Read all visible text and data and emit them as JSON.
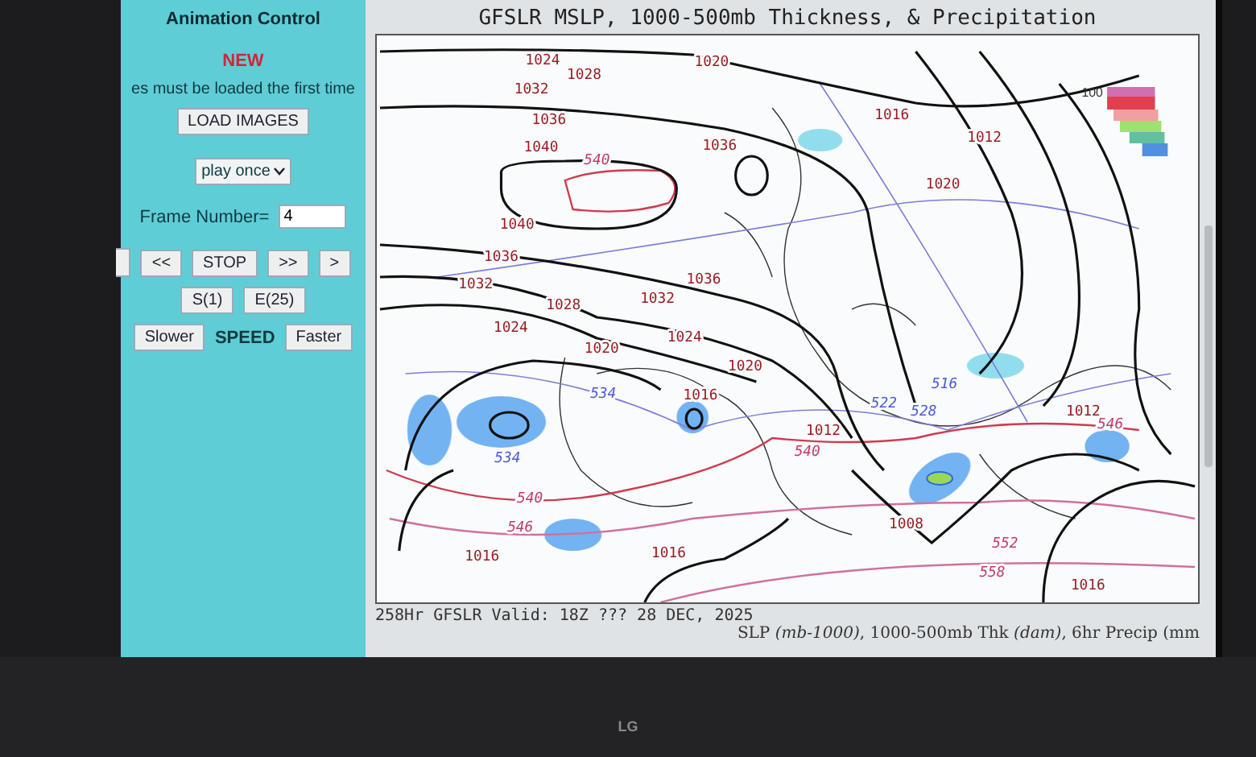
{
  "animation_control": {
    "title": "Animation Control",
    "notice_badge": "NEW",
    "notice": "es must be loaded the first time",
    "load_button": "LOAD IMAGES",
    "play_mode": "play once",
    "frame_label": "Frame Number=",
    "frame_value": "4",
    "nav_buttons": [
      "<<",
      "STOP",
      ">>",
      ">"
    ],
    "range_buttons": [
      "S(1)",
      "E(25)"
    ],
    "speed": {
      "slower": "Slower",
      "label": "SPEED",
      "faster": "Faster"
    }
  },
  "map": {
    "title": "GFSLR MSLP, 1000-500mb Thickness, & Precipitation",
    "legend_label": "100",
    "labels": [
      {
        "text": "1024",
        "kind": "pressure"
      },
      {
        "text": "1028",
        "kind": "pressure"
      },
      {
        "text": "1032",
        "kind": "pressure"
      },
      {
        "text": "1020",
        "kind": "pressure"
      },
      {
        "text": "1036",
        "kind": "pressure"
      },
      {
        "text": "1016",
        "kind": "pressure"
      },
      {
        "text": "1040",
        "kind": "pressure"
      },
      {
        "text": "1036",
        "kind": "pressure"
      },
      {
        "text": "1012",
        "kind": "pressure"
      },
      {
        "text": "1020",
        "kind": "pressure"
      },
      {
        "text": "1040",
        "kind": "pressure"
      },
      {
        "text": "1036",
        "kind": "pressure"
      },
      {
        "text": "1032",
        "kind": "pressure"
      },
      {
        "text": "1036",
        "kind": "pressure"
      },
      {
        "text": "1028",
        "kind": "pressure"
      },
      {
        "text": "1032",
        "kind": "pressure"
      },
      {
        "text": "1024",
        "kind": "pressure"
      },
      {
        "text": "1024",
        "kind": "pressure"
      },
      {
        "text": "1020",
        "kind": "pressure"
      },
      {
        "text": "1020",
        "kind": "pressure"
      },
      {
        "text": "1016",
        "kind": "pressure"
      },
      {
        "text": "1012",
        "kind": "pressure"
      },
      {
        "text": "1012",
        "kind": "pressure"
      },
      {
        "text": "1008",
        "kind": "pressure"
      },
      {
        "text": "1016",
        "kind": "pressure"
      },
      {
        "text": "1016",
        "kind": "pressure"
      },
      {
        "text": "1016",
        "kind": "pressure"
      },
      {
        "text": "540",
        "kind": "warm"
      },
      {
        "text": "534",
        "kind": "cold"
      },
      {
        "text": "534",
        "kind": "cold"
      },
      {
        "text": "516",
        "kind": "cold"
      },
      {
        "text": "522",
        "kind": "cold"
      },
      {
        "text": "528",
        "kind": "cold"
      },
      {
        "text": "540",
        "kind": "warm"
      },
      {
        "text": "546",
        "kind": "warm"
      },
      {
        "text": "540",
        "kind": "warm"
      },
      {
        "text": "546",
        "kind": "warm"
      },
      {
        "text": "552",
        "kind": "warm"
      },
      {
        "text": "558",
        "kind": "warm"
      }
    ],
    "valid_time": "258Hr GFSLR Valid: 18Z ??? 28 DEC, 2025",
    "caption": "SLP *(mb-1000)*, 1000-500mb Thk *(dam)*, 6hr Precip (mm"
  },
  "monitor": {
    "brand": "LG"
  }
}
